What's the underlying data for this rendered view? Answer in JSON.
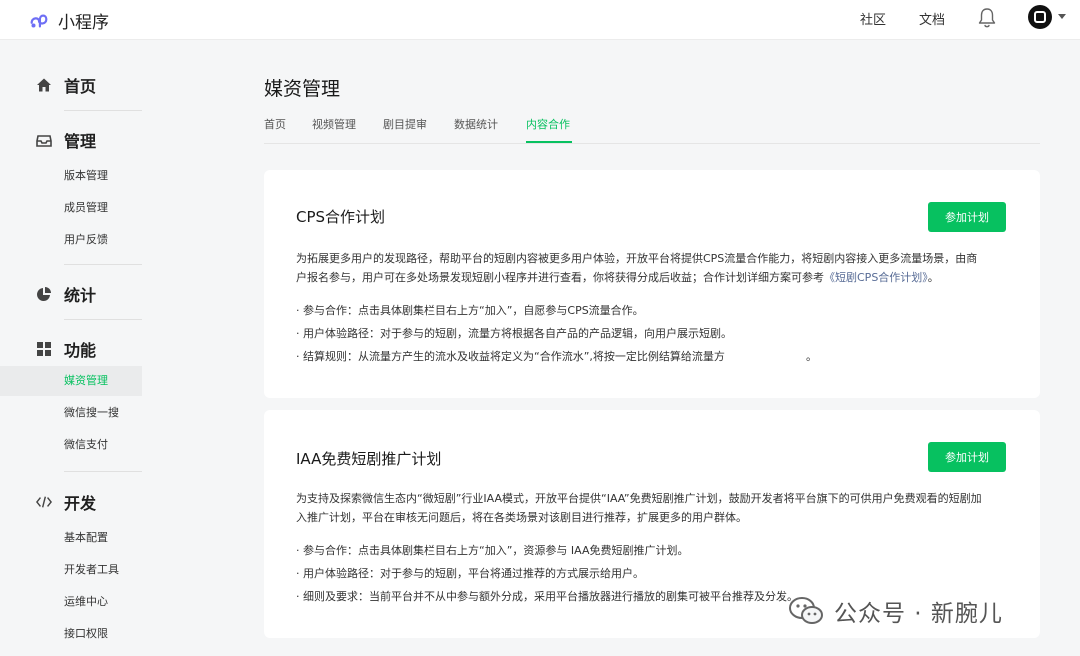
{
  "header": {
    "brand": "小程序",
    "links": [
      "社区",
      "文档"
    ]
  },
  "sidebar": {
    "sections": [
      {
        "label": "首页",
        "icon": "home-icon",
        "items": []
      },
      {
        "label": "管理",
        "icon": "inbox-icon",
        "items": [
          "版本管理",
          "成员管理",
          "用户反馈"
        ]
      },
      {
        "label": "统计",
        "icon": "pie-chart-icon",
        "items": []
      },
      {
        "label": "功能",
        "icon": "grid-icon",
        "items": [
          "媒资管理",
          "微信搜一搜",
          "微信支付"
        ]
      },
      {
        "label": "开发",
        "icon": "code-icon",
        "items": [
          "基本配置",
          "开发者工具",
          "运维中心",
          "接口权限"
        ]
      }
    ],
    "active_item": "媒资管理"
  },
  "main": {
    "title": "媒资管理",
    "tabs": [
      "首页",
      "视频管理",
      "剧目提审",
      "数据统计",
      "内容合作"
    ],
    "active_tab": "内容合作",
    "cards": [
      {
        "title": "CPS合作计划",
        "button": "参加计划",
        "desc_line1": "为拓展更多用户的发现路径，帮助平台的短剧内容被更多用户体验，开放平台将提供CPS流量合作能力，将短剧内容接入更多流量场景，由商",
        "desc_line2": "户报名参与，用户可在多处场景发现短剧小程序并进行查看，你将获得分成后收益；合作计划详细方案可参考",
        "desc_link": "《短剧CPS合作计划》",
        "desc_end": "。",
        "bullets": [
          "· 参与合作：点击具体剧集栏目右上方“加入”，自愿参与CPS流量合作。",
          "· 用户体验路径：对于参与的短剧，流量方将根据各自产品的产品逻辑，向用户展示短剧。",
          "· 结算规则：从流量方产生的流水及收益将定义为“合作流水”,将按一定比例结算给流量方",
          "。"
        ]
      },
      {
        "title": "IAA免费短剧推广计划",
        "button": "参加计划",
        "desc_line1": "为支持及探索微信生态内“微短剧”行业IAA模式，开放平台提供“IAA”免费短剧推广计划，鼓励开发者将平台旗下的可供用户免费观看的短剧加",
        "desc_line2": "入推广计划，平台在审核无问题后，将在各类场景对该剧目进行推荐，扩展更多的用户群体。",
        "bullets": [
          "· 参与合作：点击具体剧集栏目右上方“加入”，资源参与 IAA免费短剧推广计划。",
          "· 用户体验路径：对于参与的短剧，平台将通过推荐的方式展示给用户。",
          "· 细则及要求：当前平台并不从中参与额外分成，采用平台播放器进行播放的剧集可被平台推荐及分发。"
        ]
      }
    ]
  },
  "watermark": "公众号 · 新腕儿",
  "colors": {
    "accent": "#07c160",
    "link": "#576b95",
    "background": "#f5f6f7"
  }
}
